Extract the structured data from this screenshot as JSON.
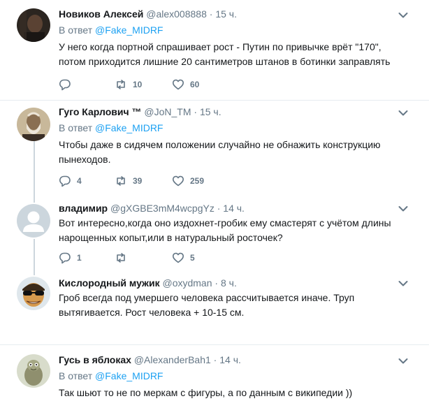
{
  "colors": {
    "link": "#1da1f2",
    "muted": "#657786",
    "text": "#14171a",
    "divider": "#e6ecf0"
  },
  "icons": {
    "reply": "reply-icon",
    "retweet": "retweet-icon",
    "like": "like-icon",
    "menu": "chevron-down-icon"
  },
  "tweets": [
    {
      "name": "Новиков Алексей",
      "handle": "@alex008888",
      "sep": "·",
      "time": "15 ч.",
      "reply_prefix": "В ответ",
      "reply_to": "@Fake_MIDRF",
      "text": "У него когда портной спрашивает рост - Путин по привычке врёт \"170\", потом приходится лишние 20 сантиметров штанов в ботинки заправлять",
      "replies": "",
      "retweets": "10",
      "likes": "60"
    },
    {
      "name": "Гуго Карлович ™",
      "handle": "@JoN_TM",
      "sep": "·",
      "time": "15 ч.",
      "reply_prefix": "В ответ",
      "reply_to": "@Fake_MIDRF",
      "text": "Чтобы даже в сидячем положении случайно не обнажить конструкцию пынеходов.",
      "replies": "4",
      "retweets": "39",
      "likes": "259"
    },
    {
      "name": "владимир",
      "handle": "@gXGBE3mM4wcpgYz",
      "sep": "·",
      "time": "14 ч.",
      "text": "Вот интересно,когда оно издохнет-гробик ему смастерят с учётом длины нарощенных копыт,или в натуральный росточек?",
      "replies": "1",
      "retweets": "",
      "likes": "5"
    },
    {
      "name": "Кислородный мужик",
      "handle": "@oxydman",
      "sep": "·",
      "time": "8 ч.",
      "text": "Гроб всегда под умершего человека  рассчитывается иначе. Труп вытягивается. Рост человека + 10-15 см."
    },
    {
      "name": "Гусь в яблоках",
      "handle": "@AlexanderBah1",
      "sep": "·",
      "time": "14 ч.",
      "reply_prefix": "В ответ",
      "reply_to": "@Fake_MIDRF",
      "text": "Так шьют то не по меркам с фигуры, а по данным с википедии ))"
    }
  ]
}
